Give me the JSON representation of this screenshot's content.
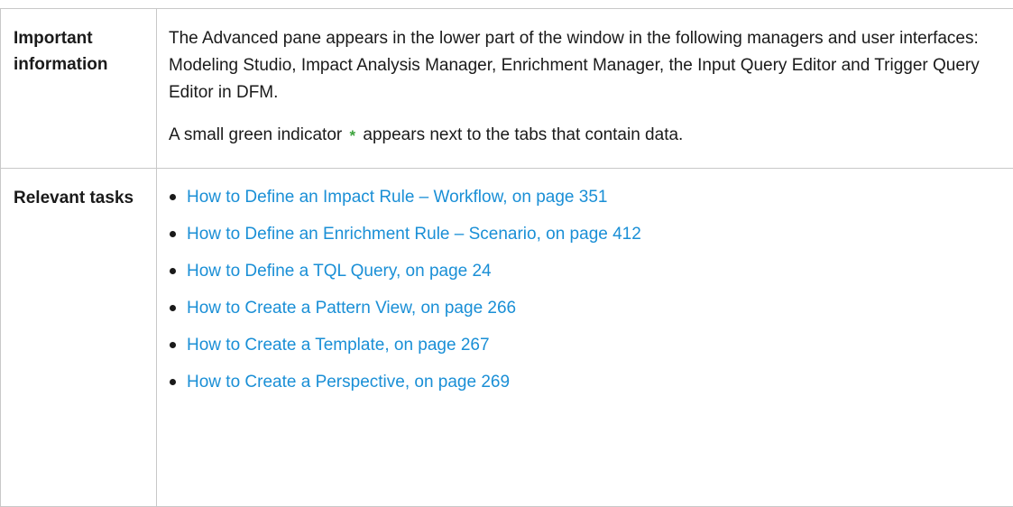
{
  "rows": {
    "important": {
      "label": "Important information",
      "paragraph1": "The Advanced pane appears in the lower part of the window in the following managers and user interfaces: Modeling Studio, Impact Analysis Manager, Enrichment Manager, the Input Query Editor and Trigger Query Editor in DFM.",
      "paragraph2_before": "A small green indicator ",
      "indicator_icon": "*",
      "paragraph2_after": " appears next to the tabs that contain data."
    },
    "tasks": {
      "label": "Relevant tasks",
      "links": [
        "How to Define an Impact Rule – Workflow, on page 351",
        "How to Define an Enrichment Rule – Scenario, on page 412",
        "How to Define a TQL Query, on page 24",
        "How to Create a Pattern View, on page 266",
        "How to Create a Template, on page 267",
        "How to Create a Perspective, on page 269"
      ]
    }
  },
  "colors": {
    "link": "#1a8fd6",
    "indicator": "#3da33d",
    "border": "#c8c8c8"
  }
}
